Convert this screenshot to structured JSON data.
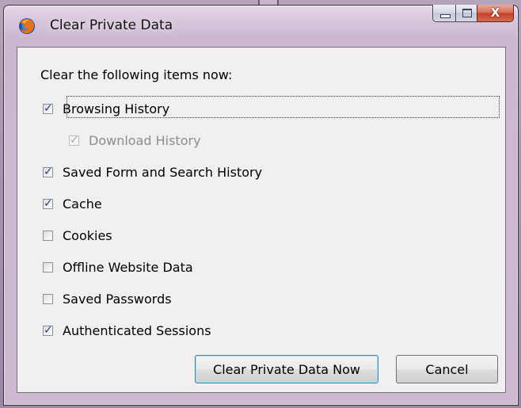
{
  "window": {
    "title": "Clear Private Data",
    "close_glyph": "X"
  },
  "dialog": {
    "heading": "Clear the following items now:",
    "items": [
      {
        "label": "Browsing History",
        "checked": true,
        "enabled": true
      },
      {
        "label": "Download History",
        "checked": true,
        "enabled": false
      },
      {
        "label": "Saved Form and Search History",
        "checked": true,
        "enabled": true
      },
      {
        "label": "Cache",
        "checked": true,
        "enabled": true
      },
      {
        "label": "Cookies",
        "checked": false,
        "enabled": true
      },
      {
        "label": "Offline Website Data",
        "checked": false,
        "enabled": true
      },
      {
        "label": "Saved Passwords",
        "checked": false,
        "enabled": true
      },
      {
        "label": "Authenticated Sessions",
        "checked": true,
        "enabled": true
      }
    ],
    "check_mark": "✓",
    "buttons": {
      "clear_now": "Clear Private Data Now",
      "cancel": "Cancel"
    }
  },
  "colors": {
    "title_bar": "#d8c6dc",
    "close_button": "#c7402a",
    "dialog_face": "#f0f0f0",
    "checkmark": "#2a3a8c",
    "default_button_border": "#3c7fb1"
  },
  "icons": {
    "app": "firefox-icon"
  }
}
